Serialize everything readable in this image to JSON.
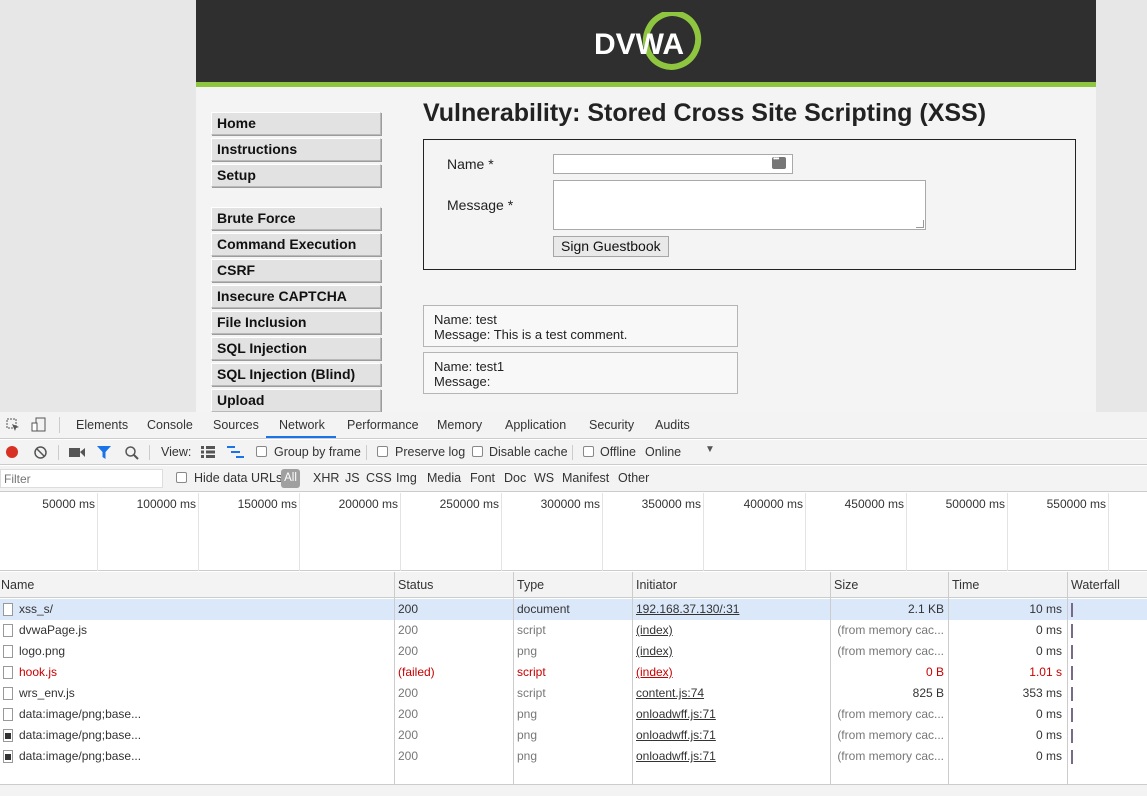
{
  "page": {
    "logo_text": "DVWA",
    "menu": [
      "Home",
      "Instructions",
      "Setup",
      "Brute Force",
      "Command Execution",
      "CSRF",
      "Insecure CAPTCHA",
      "File Inclusion",
      "SQL Injection",
      "SQL Injection (Blind)",
      "Upload"
    ],
    "title": "Vulnerability: Stored Cross Site Scripting (XSS)",
    "form": {
      "name_label": "Name *",
      "message_label": "Message *",
      "name_value": "",
      "message_value": "",
      "button_label": "Sign Guestbook"
    },
    "comments": [
      {
        "name": "Name: test",
        "message": "Message: This is a test comment."
      },
      {
        "name": "Name: test1",
        "message": "Message:"
      }
    ]
  },
  "devtools": {
    "tabs": [
      "Elements",
      "Console",
      "Sources",
      "Network",
      "Performance",
      "Memory",
      "Application",
      "Security",
      "Audits"
    ],
    "active_tab": "Network",
    "toolbar": {
      "view_label": "View:",
      "group_by_frame": "Group by frame",
      "preserve_log": "Preserve log",
      "disable_cache": "Disable cache",
      "offline": "Offline",
      "throttle": "Online"
    },
    "filter": {
      "placeholder": "Filter",
      "hide_data_urls": "Hide data URLs",
      "types": [
        "All",
        "XHR",
        "JS",
        "CSS",
        "Img",
        "Media",
        "Font",
        "Doc",
        "WS",
        "Manifest",
        "Other"
      ],
      "active_type": "All"
    },
    "timeline_ticks": [
      "50000 ms",
      "100000 ms",
      "150000 ms",
      "200000 ms",
      "250000 ms",
      "300000 ms",
      "350000 ms",
      "400000 ms",
      "450000 ms",
      "500000 ms",
      "550000 ms"
    ],
    "columns": [
      "Name",
      "Status",
      "Type",
      "Initiator",
      "Size",
      "Time",
      "Waterfall"
    ],
    "rows": [
      {
        "name": "xss_s/",
        "status": "200",
        "type": "document",
        "initiator": "192.168.37.130/:31",
        "size": "2.1 KB",
        "time": "10 ms",
        "selected": true,
        "failed": false
      },
      {
        "name": "dvwaPage.js",
        "status": "200",
        "type": "script",
        "initiator": "(index)",
        "size": "(from memory cac...",
        "time": "0 ms",
        "selected": false,
        "failed": false
      },
      {
        "name": "logo.png",
        "status": "200",
        "type": "png",
        "initiator": "(index)",
        "size": "(from memory cac...",
        "time": "0 ms",
        "selected": false,
        "failed": false
      },
      {
        "name": "hook.js",
        "status": "(failed)",
        "type": "script",
        "initiator": "(index)",
        "size": "0 B",
        "time": "1.01 s",
        "selected": false,
        "failed": true
      },
      {
        "name": "wrs_env.js",
        "status": "200",
        "type": "script",
        "initiator": "content.js:74",
        "size": "825 B",
        "time": "353 ms",
        "selected": false,
        "failed": false
      },
      {
        "name": "data:image/png;base...",
        "status": "200",
        "type": "png",
        "initiator": "onloadwff.js:71",
        "size": "(from memory cac...",
        "time": "0 ms",
        "selected": false,
        "failed": false
      },
      {
        "name": "data:image/png;base...",
        "status": "200",
        "type": "png",
        "initiator": "onloadwff.js:71",
        "size": "(from memory cac...",
        "time": "0 ms",
        "selected": false,
        "failed": false
      },
      {
        "name": "data:image/png;base...",
        "status": "200",
        "type": "png",
        "initiator": "onloadwff.js:71",
        "size": "(from memory cac...",
        "time": "0 ms",
        "selected": false,
        "failed": false
      }
    ],
    "colors": {
      "accent": "#1a73e8",
      "record": "#d93025",
      "failed": "#c80000",
      "header_green": "#8fc63f"
    }
  }
}
